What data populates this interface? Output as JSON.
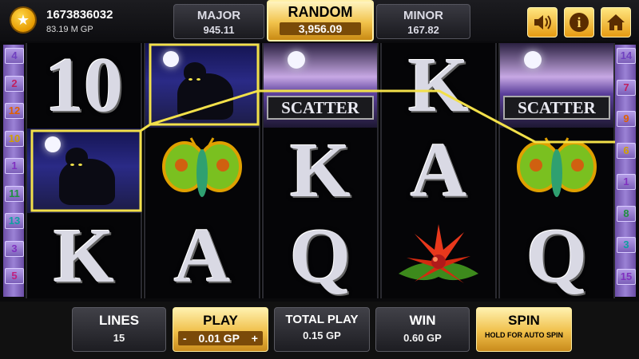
{
  "player": {
    "id": "1673836032",
    "balance": "83.19 M GP"
  },
  "jackpots": {
    "major": {
      "label": "MAJOR",
      "value": "945.11"
    },
    "random": {
      "label": "RANDOM",
      "value": "3,956.09"
    },
    "minor": {
      "label": "MINOR",
      "value": "167.82"
    }
  },
  "top_buttons": {
    "sound": "sound-icon",
    "info": "i",
    "home": "home-icon"
  },
  "payline_numbers": {
    "left": [
      "4",
      "2",
      "12",
      "10",
      "1",
      "11",
      "13",
      "3",
      "5"
    ],
    "right": [
      "14",
      "7",
      "9",
      "6",
      "1",
      "8",
      "3",
      "15"
    ]
  },
  "reels": [
    [
      {
        "type": "letter",
        "text": "10"
      },
      {
        "type": "panther"
      },
      {
        "type": "letter",
        "text": "K"
      }
    ],
    [
      {
        "type": "panther"
      },
      {
        "type": "moth"
      },
      {
        "type": "letter",
        "text": "A"
      }
    ],
    [
      {
        "type": "scatter",
        "text": "SCATTER"
      },
      {
        "type": "letter",
        "text": "K"
      },
      {
        "type": "letter",
        "text": "Q"
      }
    ],
    [
      {
        "type": "letter",
        "text": "K"
      },
      {
        "type": "letter",
        "text": "A"
      },
      {
        "type": "flower"
      }
    ],
    [
      {
        "type": "scatter",
        "text": "SCATTER"
      },
      {
        "type": "moth"
      },
      {
        "type": "letter",
        "text": "Q"
      }
    ]
  ],
  "controls": {
    "lines": {
      "label": "LINES",
      "value": "15"
    },
    "play": {
      "label": "PLAY",
      "value": "0.01 GP",
      "minus": "-",
      "plus": "+"
    },
    "total_play": {
      "label": "TOTAL PLAY",
      "value": "0.15 GP"
    },
    "win": {
      "label": "WIN",
      "value": "0.60 GP"
    },
    "spin": {
      "label": "SPIN",
      "hint": "HOLD FOR AUTO SPIN"
    }
  },
  "colors": {
    "accent_gold": "#f0c04a",
    "payline": "#f2e04a",
    "side_purple": "#8a6cc8"
  }
}
